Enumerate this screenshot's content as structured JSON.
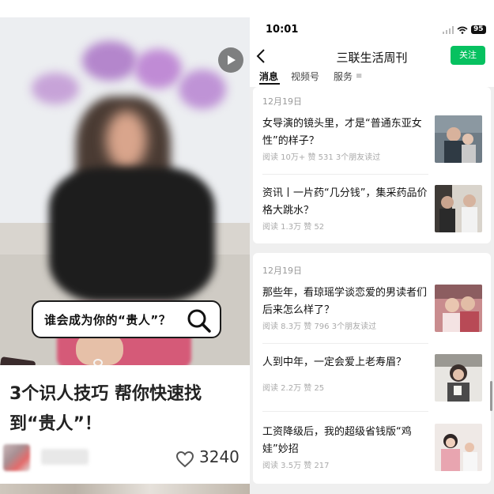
{
  "left_card": {
    "search_text": "谁会成为你的“贵人”？",
    "title": "3个识人技巧 帮你快速找到“贵人”！",
    "like_count": "3240",
    "icons": {
      "play": "play-icon",
      "search": "search-icon",
      "like": "heart-icon"
    }
  },
  "status_bar": {
    "time": "10:01",
    "battery": "95"
  },
  "navbar": {
    "title": "三联生活周刊",
    "follow_label": "关注"
  },
  "tabs": [
    {
      "label": "消息"
    },
    {
      "label": "视频号"
    },
    {
      "label": "服务"
    }
  ],
  "groups": [
    {
      "date": "12月19日",
      "articles": [
        {
          "title": "女导演的镜头里，才是“普通东亚女性”的样子？",
          "meta": "阅读 10万+  赞 531  3个朋友读过"
        },
        {
          "title": "资讯丨一片药“几分钱”，集采药品价格大跳水？",
          "meta": "阅读 1.3万  赞 52"
        }
      ]
    },
    {
      "date": "12月19日",
      "articles": [
        {
          "title": "那些年，看琼瑶学谈恋爱的男读者们后来怎么样了？",
          "meta": "阅读 8.3万  赞 796  3个朋友读过"
        },
        {
          "title": "人到中年，一定会爱上老寿眉？",
          "meta": "阅读 2.2万  赞 25"
        },
        {
          "title": "工资降级后，我的超级省钱版“鸡娃”妙招",
          "meta": "阅读 3.5万  赞 217"
        }
      ]
    }
  ],
  "colors": {
    "accent_green": "#07c160",
    "meta_gray": "#aaaaaa"
  }
}
